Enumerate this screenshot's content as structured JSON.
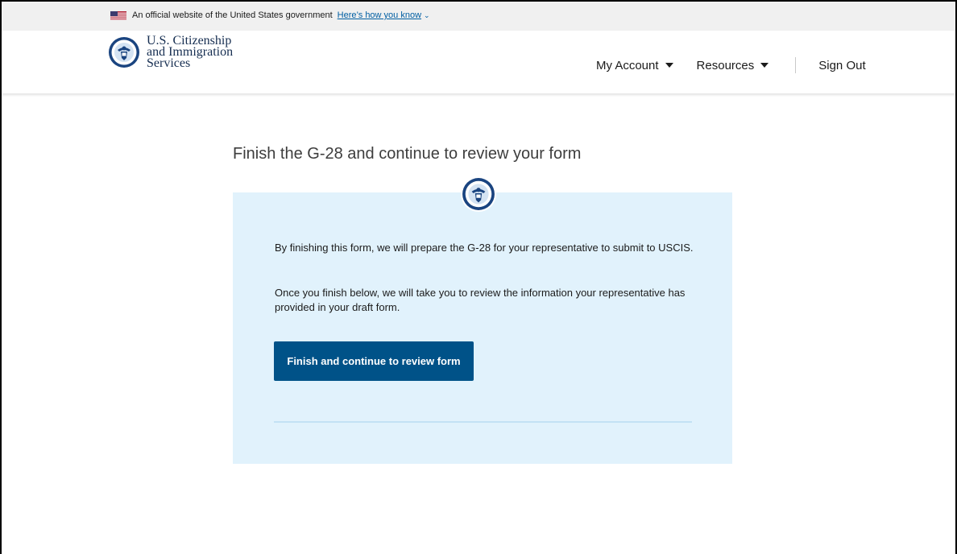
{
  "gov_banner": {
    "text": "An official website of the United States government",
    "link": "Here’s how you know",
    "flag_icon": "us-flag-icon",
    "chevron_icon": "chevron-down-icon"
  },
  "header": {
    "agency_name_line1": "U.S. Citizenship",
    "agency_name_line2": "and Immigration",
    "agency_name_line3": "Services",
    "seal_icon": "dhs-seal-icon",
    "nav": {
      "my_account": "My Account",
      "resources": "Resources",
      "sign_out": "Sign Out"
    }
  },
  "main": {
    "title": "Finish the G-28 and continue to review your form",
    "paragraph1": "By finishing this form, we will prepare the G-28 for your representative to submit to USCIS.",
    "paragraph2": "Once you finish below, we will take you to review the information your representative has provided in your draft form.",
    "button_label": "Finish and continue to review form"
  },
  "colors": {
    "primary_button": "#005288",
    "panel_background": "#e1f2fc",
    "link": "#005ea2",
    "banner_background": "#f0f0f0"
  }
}
